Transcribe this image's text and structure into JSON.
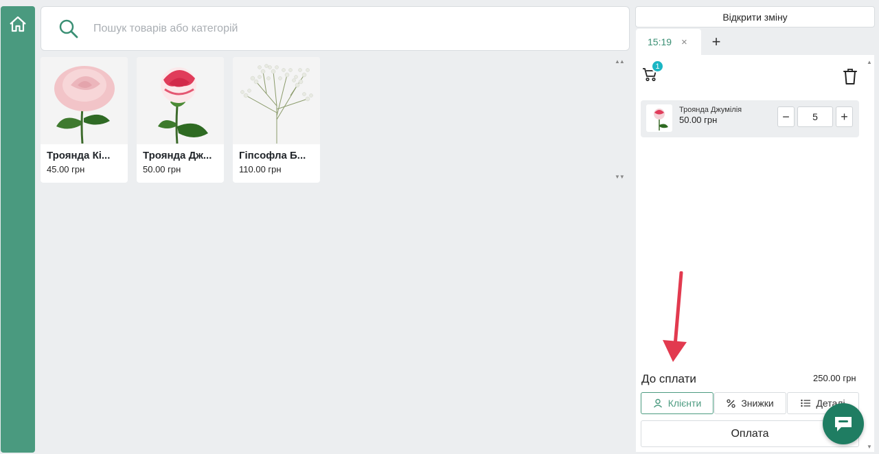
{
  "search": {
    "placeholder": "Пошук товарів або категорій"
  },
  "products": [
    {
      "name": "Троянда Кі...",
      "price": "45.00 грн",
      "image": "pink-rose"
    },
    {
      "name": "Троянда Дж...",
      "price": "50.00 грн",
      "image": "bicolor-rose"
    },
    {
      "name": "Гіпсофла Б...",
      "price": "110.00 грн",
      "image": "gypsophila"
    }
  ],
  "header": {
    "open_shift_label": "Відкрити зміну"
  },
  "tabs": [
    {
      "label": "15:19",
      "close": "×"
    }
  ],
  "tab_add": "+",
  "cart": {
    "badge_count": "1",
    "items": [
      {
        "name": "Троянда Джумілія",
        "price": "50.00 грн",
        "quantity": "5",
        "minus": "−",
        "plus": "+"
      }
    ]
  },
  "totals": {
    "label": "До сплати",
    "value": "250.00 грн"
  },
  "actions": {
    "clients_label": "Клієнти",
    "discounts_label": "Знижки",
    "details_label": "Деталі"
  },
  "pay": {
    "label": "Оплата"
  },
  "colors": {
    "accent": "#4a9a7f",
    "badge": "#1bb6c4",
    "arrow": "#e23a4f",
    "chat": "#1f7d62"
  }
}
